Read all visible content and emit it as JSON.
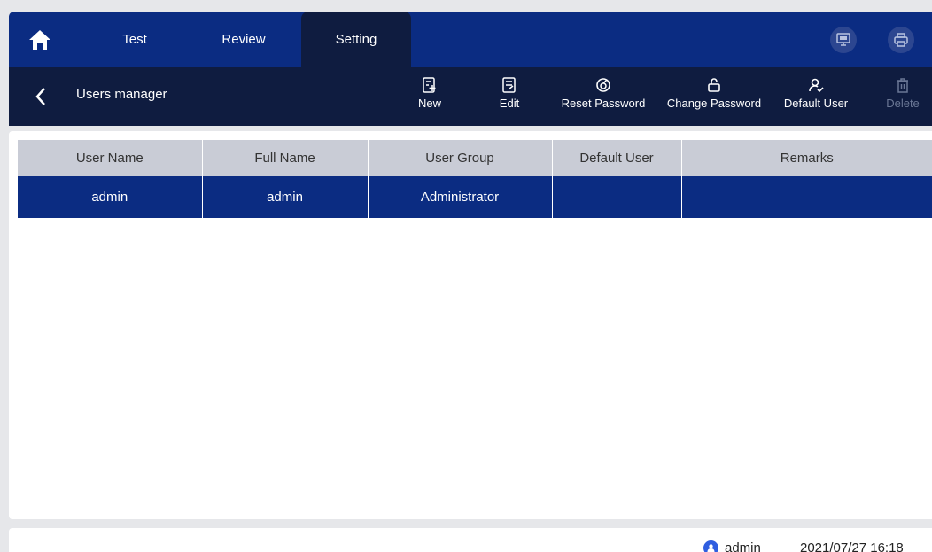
{
  "tabs": [
    {
      "label": "Test"
    },
    {
      "label": "Review"
    },
    {
      "label": "Setting",
      "active": true
    }
  ],
  "topbar_icons": [
    "home-icon",
    "lis-monitor-icon",
    "printer-icon"
  ],
  "subbar": {
    "title": "Users manager",
    "tools": {
      "new": "New",
      "edit": "Edit",
      "reset_password": "Reset Password",
      "change_password": "Change Password",
      "default_user": "Default User",
      "delete": "Delete"
    }
  },
  "table": {
    "columns": [
      "User Name",
      "Full Name",
      "User Group",
      "Default User",
      "Remarks"
    ],
    "rows": [
      [
        "admin",
        "admin",
        "Administrator",
        "",
        ""
      ]
    ]
  },
  "status": {
    "user": "admin",
    "datetime": "2021/07/27 16:18"
  },
  "colors": {
    "primary": "#0b2c82",
    "dark": "#0f1c40",
    "header_gray": "#c9ccd6",
    "user_blue": "#2f5ee0"
  }
}
